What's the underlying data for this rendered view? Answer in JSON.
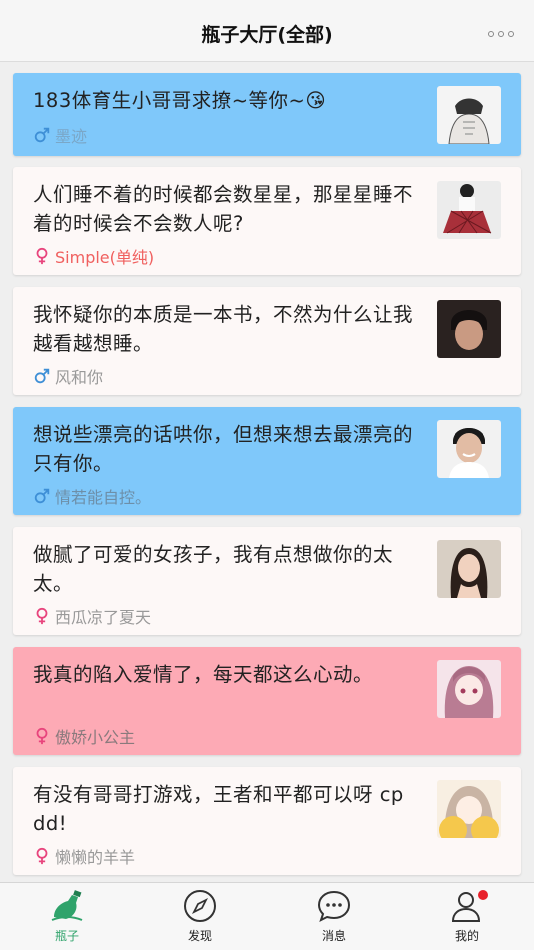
{
  "header": {
    "title": "瓶子大厅(全部)"
  },
  "cards": [
    {
      "text": "183体育生小哥哥求撩~等你~😘",
      "author": "墨迹",
      "gender": "male",
      "bg": "#7fc8fa"
    },
    {
      "text": "人们睡不着的时候都会数星星，那星星睡不着的时候会不会数人呢?",
      "author": "Simple(单纯)",
      "gender": "female",
      "bg": "#fdf8f7",
      "author_color": "#f0605f"
    },
    {
      "text": "我怀疑你的本质是一本书，不然为什么让我越看越想睡。",
      "author": "风和你",
      "gender": "male",
      "bg": "#fdf8f7"
    },
    {
      "text": "想说些漂亮的话哄你，但想来想去最漂亮的只有你。",
      "author": "情若能自控。",
      "gender": "male",
      "bg": "#7fc8fa"
    },
    {
      "text": "做腻了可爱的女孩子，我有点想做你的太太。",
      "author": "西瓜凉了夏天",
      "gender": "female",
      "bg": "#fdf8f7"
    },
    {
      "text": "我真的陷入爱情了，每天都这么心动。",
      "author": "傲娇小公主",
      "gender": "female",
      "bg": "#fdaab5"
    },
    {
      "text": "有没有哥哥打游戏，王者和平都可以呀 cpdd!",
      "author": "懒懒的羊羊",
      "gender": "female",
      "bg": "#fdf8f7"
    }
  ],
  "tabs": [
    {
      "label": "瓶子",
      "icon": "bottle-icon",
      "active": true
    },
    {
      "label": "发现",
      "icon": "compass-icon",
      "active": false
    },
    {
      "label": "消息",
      "icon": "message-icon",
      "active": false
    },
    {
      "label": "我的",
      "icon": "profile-icon",
      "active": false,
      "badge": true
    }
  ],
  "colors": {
    "male": "#3e8fd6",
    "female": "#e8457d",
    "active_tab": "#2fa36b",
    "badge": "#e8202a"
  }
}
